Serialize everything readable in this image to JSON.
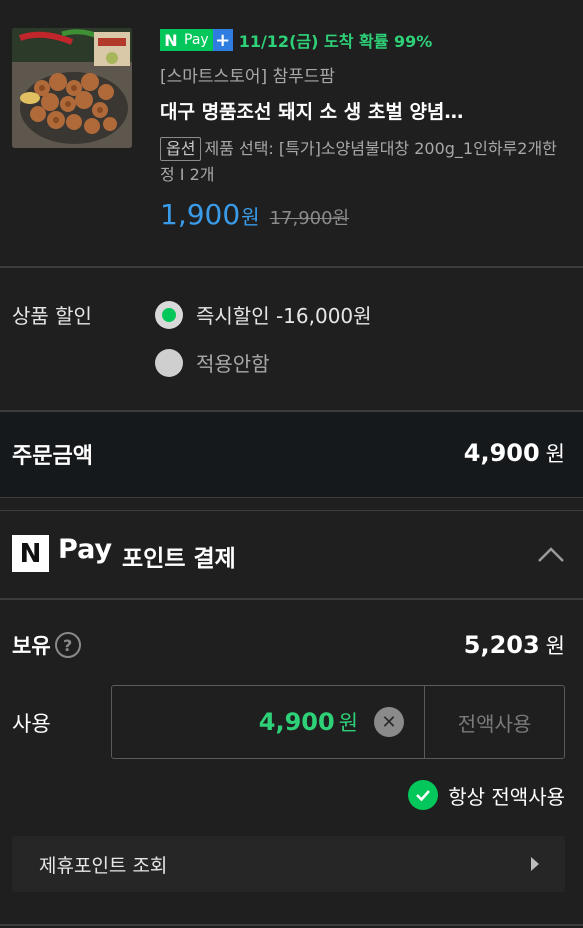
{
  "product": {
    "npay_badge": {
      "n": "N",
      "pay": "Pay",
      "plus": "+"
    },
    "delivery": "11/12(금) 도착 확률 99%",
    "store": "[스마트스토어] 참푸드팜",
    "title": "대구 명품조선 돼지 소 생 초벌 양념…",
    "option_badge": "옵션",
    "option_text": "제품 선택: [특가]소양념불대창 200g_1인하루2개한정 I 2개",
    "price": "1,900",
    "price_unit": "원",
    "original_price": "17,900원"
  },
  "discount": {
    "label": "상품 할인",
    "options": [
      {
        "label": "즉시할인 -16,000원",
        "selected": true
      },
      {
        "label": "적용안함",
        "selected": false
      }
    ]
  },
  "order": {
    "label": "주문금액",
    "amount": "4,900",
    "unit": "원"
  },
  "points": {
    "logo_n": "N",
    "logo_pay": "Pay",
    "title": "포인트 결제",
    "holding_label": "보유",
    "holding_help": "?",
    "holding_amount": "5,203",
    "holding_unit": "원",
    "use_label": "사용",
    "use_value": "4,900",
    "use_unit": "원",
    "use_all_button": "전액사용",
    "always_use_all": "항상 전액사용",
    "partner_points": "제휴포인트 조회"
  },
  "colors": {
    "accent_green": "#03c75a",
    "price_blue": "#3a9be8",
    "background": "#1f1f1f"
  }
}
